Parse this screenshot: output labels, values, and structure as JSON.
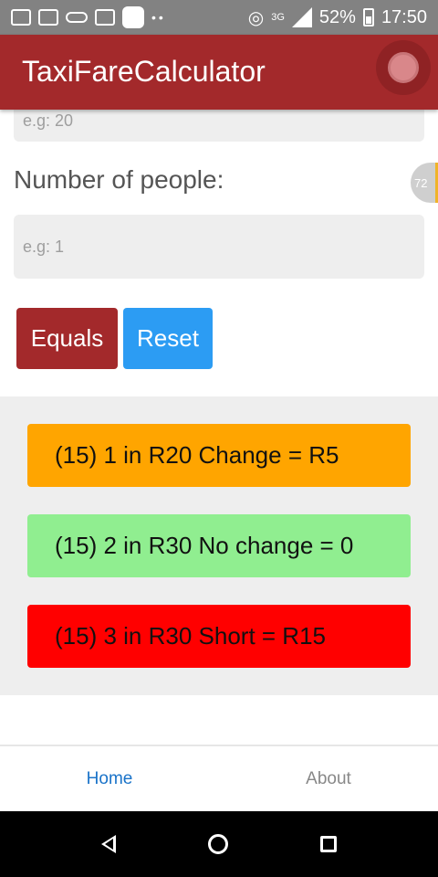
{
  "status_bar": {
    "network": "3G",
    "battery": "52%",
    "time": "17:50"
  },
  "app_bar": {
    "title": "TaxiFareCalculator"
  },
  "form": {
    "top_input_placeholder": "e.g: 20",
    "people_label": "Number of people:",
    "people_placeholder": "e.g: 1",
    "scroll_badge": "72"
  },
  "buttons": {
    "equals": "Equals",
    "reset": "Reset"
  },
  "results": [
    {
      "text": "(15) 1 in R20 Change = R5",
      "color": "#ffa500"
    },
    {
      "text": "(15) 2 in R30 No change = 0",
      "color": "#90ee90"
    },
    {
      "text": "(15) 3 in R30 Short = R15",
      "color": "#ff0000"
    }
  ],
  "tabs": [
    {
      "label": "Home",
      "active": true
    },
    {
      "label": "About",
      "active": false
    }
  ],
  "colors": {
    "primary": "#a3292b",
    "accent": "#2c9cf3",
    "tab_active": "#1a73c9"
  }
}
